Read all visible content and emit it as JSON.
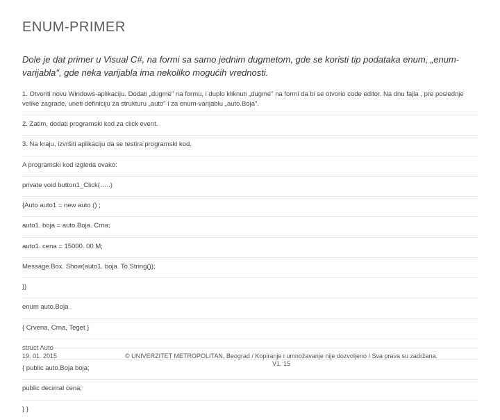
{
  "title": "ENUM-PRIMER",
  "intro": "Dole je dat primer u Visual C#, na formi sa samo jednim dugmetom, gde se koristi tip podataka enum, „enum-varijabla\", gde neka varijabla ima nekoliko mogućih vrednosti.",
  "lines": [
    " 1. Otvoriti novu Windows-aplikaciju. Dodati „dugme\" na formu, i duplo kliknuti „dugme\" na formi da bi se otvorio code editor. Na dnu fajla , pre poslednje velike zagrade, uneti definiciju za strukturu „auto\" i za enum-varijablu „auto.Boja\".",
    "2. Zatim, dodati programski kod za click event.",
    "3. Na kraju, izvršiti aplikaciju da se testira programski kod.",
    " A programski kod izgleda ovako:",
    "private void button1_Click(…..)",
    "{Auto auto1 = new auto () ;",
    "auto1. boja = auto.Boja. Crna;",
    "auto1. cena = 15000. 00 M;",
    "Message.Box. Show(auto1. boja. To.String());",
    "}}",
    "enum auto.Boja",
    "{                        Crvena, Crna, Teget   }",
    "struct Auto",
    "{                        public auto.Boja boja;",
    "                          public decimal cena;",
    "} }"
  ],
  "footer": {
    "date": "19. 01. 2015",
    "copyright": "© UNIVERZITET METROPOLITAN, Beograd / Kopiranje i umnožavanje nije dozvoljeno / Sva prava su zadržana.",
    "version": "V1. 15"
  }
}
